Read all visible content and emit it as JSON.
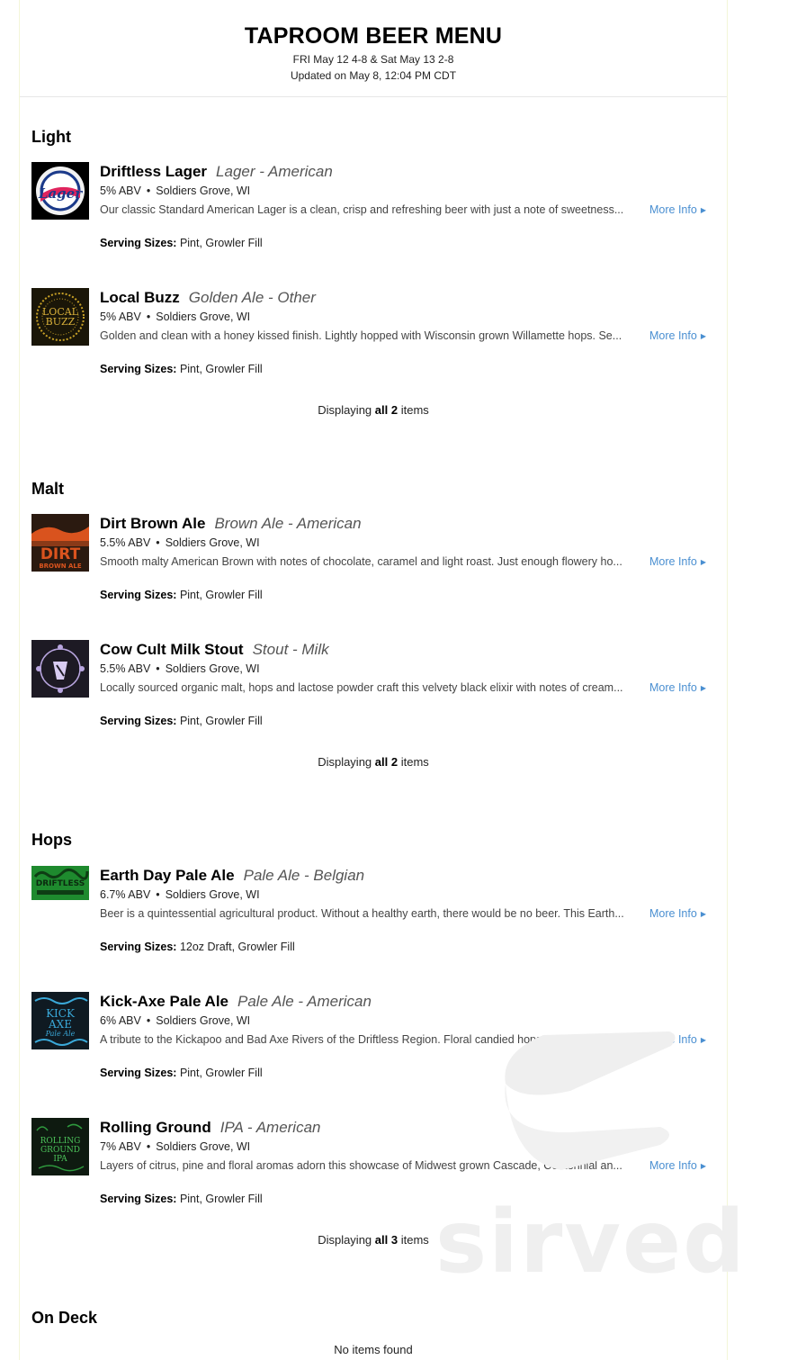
{
  "header": {
    "title": "TAPROOM BEER MENU",
    "schedule": "FRI May 12 4-8 & Sat May 13 2-8",
    "updated": "Updated on May 8, 12:04 PM CDT"
  },
  "labels": {
    "more_info": "More Info",
    "serving_sizes": "Serving Sizes:",
    "displaying": "Displaying",
    "all": "all",
    "items": "items",
    "no_items": "No items found"
  },
  "sections": [
    {
      "title": "Light",
      "count": "2",
      "items": [
        {
          "name": "Driftless Lager",
          "style": "Lager - American",
          "abv": "5% ABV",
          "location": "Soldiers Grove, WI",
          "description": "Our classic Standard American Lager is a clean, crisp and refreshing beer with just a note of sweetness...",
          "serving": "Pint, Growler Fill",
          "logo_bg": "#000000"
        },
        {
          "name": "Local Buzz",
          "style": "Golden Ale - Other",
          "abv": "5% ABV",
          "location": "Soldiers Grove, WI",
          "description": "Golden and clean with a honey kissed finish. Lightly hopped with Wisconsin grown Willamette hops. Se...",
          "serving": "Pint, Growler Fill",
          "logo_bg": "#1a1608"
        }
      ]
    },
    {
      "title": "Malt",
      "count": "2",
      "items": [
        {
          "name": "Dirt Brown Ale",
          "style": "Brown Ale - American",
          "abv": "5.5% ABV",
          "location": "Soldiers Grove, WI",
          "description": "Smooth malty American Brown with notes of chocolate, caramel and light roast. Just enough flowery ho...",
          "serving": "Pint, Growler Fill",
          "logo_bg": "#2b1a10"
        },
        {
          "name": "Cow Cult Milk Stout",
          "style": "Stout - Milk",
          "abv": "5.5% ABV",
          "location": "Soldiers Grove, WI",
          "description": "Locally sourced organic malt, hops and lactose powder craft this velvety black elixir with notes of cream...",
          "serving": "Pint, Growler Fill",
          "logo_bg": "#1d1a24"
        }
      ]
    },
    {
      "title": "Hops",
      "count": "3",
      "items": [
        {
          "name": "Earth Day Pale Ale",
          "style": "Pale Ale - Belgian",
          "abv": "6.7% ABV",
          "location": "Soldiers Grove, WI",
          "description": "Beer is a quintessential agricultural product. Without a healthy earth, there would be no beer. This Earth...",
          "serving": "12oz Draft, Growler Fill",
          "logo_bg": "#1e8a2e"
        },
        {
          "name": "Kick-Axe Pale Ale",
          "style": "Pale Ale - American",
          "abv": "6% ABV",
          "location": "Soldiers Grove, WI",
          "description": "A tribute to the Kickapoo and Bad Axe Rivers of the Driftless Region. Floral candied hops meander into ...",
          "serving": "Pint, Growler Fill",
          "logo_bg": "#0f1a22"
        },
        {
          "name": "Rolling Ground",
          "style": "IPA - American",
          "abv": "7% ABV",
          "location": "Soldiers Grove, WI",
          "description": "Layers of citrus, pine and floral aromas adorn this showcase of Midwest grown Cascade, Centennial an...",
          "serving": "Pint, Growler Fill",
          "logo_bg": "#0e1a10"
        }
      ]
    },
    {
      "title": "On Deck",
      "count": "0",
      "items": []
    }
  ],
  "watermark": {
    "text": "sirved",
    "icon": "knife-icon",
    "color": "#eeeeee"
  }
}
